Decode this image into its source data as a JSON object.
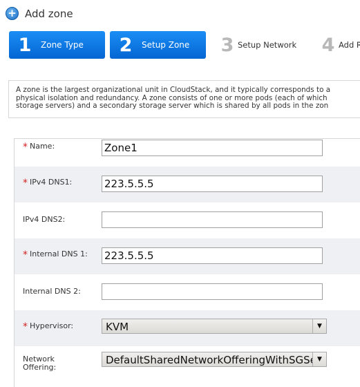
{
  "header": {
    "title": "Add zone",
    "icon": "add-circle-icon"
  },
  "steps": [
    {
      "number": "1",
      "label": "Zone Type"
    },
    {
      "number": "2",
      "label": "Setup Zone"
    },
    {
      "number": "3",
      "label": "Setup Network"
    },
    {
      "number": "4",
      "label": "Add R"
    }
  ],
  "description": {
    "line1": "A zone is the largest organizational unit in CloudStack, and it typically corresponds to a",
    "line2": "physical isolation and redundancy. A zone consists of one or more pods (each of which",
    "line3": "storage servers) and a secondary storage server which is shared by all pods in the zon"
  },
  "form": {
    "name": {
      "label": "Name:",
      "value": "Zone1",
      "required": true
    },
    "ipv4_dns1": {
      "label": "IPv4 DNS1:",
      "value": "223.5.5.5",
      "required": true
    },
    "ipv4_dns2": {
      "label": "IPv4 DNS2:",
      "value": "",
      "required": false
    },
    "internal_dns1": {
      "label": "Internal DNS 1:",
      "value": "223.5.5.5",
      "required": true
    },
    "internal_dns2": {
      "label": "Internal DNS 2:",
      "value": "",
      "required": false
    },
    "hypervisor": {
      "label": "Hypervisor:",
      "value": "KVM",
      "required": true
    },
    "network_offering": {
      "label_line1": "Network",
      "label_line2": "Offering:",
      "value": "DefaultSharedNetworkOfferingWithSGSer"
    }
  },
  "colors": {
    "accent": "#0d7be6",
    "required": "#d42222",
    "row_shade": "#eef0f3"
  }
}
